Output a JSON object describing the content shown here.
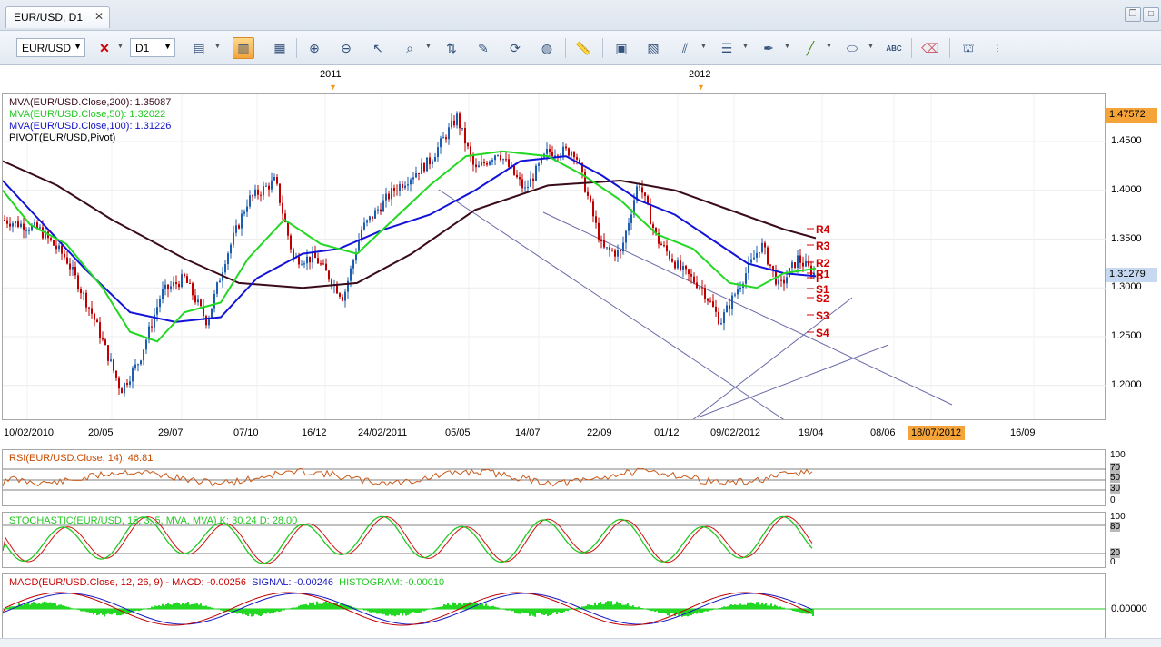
{
  "window": {
    "tab_title": "EUR/USD, D1",
    "close": "✕"
  },
  "toolbar": {
    "symbol": "EUR/USD",
    "timeframe": "D1",
    "buttons": [
      "chart-type",
      "crosshair-remove",
      "indicators",
      "candles",
      "bars",
      "zoom-in",
      "zoom-out",
      "cursor",
      "magnify",
      "trendline",
      "fib",
      "reload",
      "globe",
      "ruler",
      "picture",
      "template",
      "channel",
      "levels",
      "pen",
      "line",
      "ellipse",
      "text",
      "eraser",
      "tree"
    ]
  },
  "price_chart": {
    "top_labels": {
      "y2011": "2011",
      "y2012": "2012"
    },
    "legend": {
      "ma200": "MVA(EUR/USD.Close,200): 1.35087",
      "ma50": "MVA(EUR/USD.Close,50): 1.32022",
      "ma100": "MVA(EUR/USD.Close,100): 1.31226",
      "pivot": "PIVOT(EUR/USD,Pivot)"
    },
    "colors": {
      "ma200": "#3a0b1a",
      "ma50": "#22d822",
      "ma100": "#1313d8",
      "up": "#1e5eb0",
      "down": "#c00000",
      "pivot": "#d00000",
      "channel": "#6a6aa8"
    },
    "y_ticks": [
      "1.4500",
      "1.4000",
      "1.3500",
      "1.3000",
      "1.2500",
      "1.2000"
    ],
    "price_high_badge": "1.47572",
    "price_current_badge": "1.31279",
    "pivot_labels": [
      "R4",
      "R3",
      "R2",
      "R1",
      "P",
      "S1",
      "S2",
      "S3",
      "S4"
    ],
    "x_ticks": [
      "10/02/2010",
      "20/05",
      "29/07",
      "07/10",
      "16/12",
      "24/02/2011",
      "05/05",
      "14/07",
      "22/09",
      "01/12",
      "09/02/2012",
      "19/04",
      "08/06",
      "18/07/2012",
      "16/09"
    ]
  },
  "rsi": {
    "legend": "RSI(EUR/USD.Close, 14): 46.81",
    "ticks": [
      "100",
      "70",
      "50",
      "30",
      "0"
    ]
  },
  "stochastic": {
    "legend": "STOCHASTIC(EUR/USD, 15, 3, 5, MVA, MVA) K: 30.24  D: 28.00",
    "ticks": [
      "100",
      "80",
      "20",
      "0"
    ]
  },
  "macd": {
    "legend_main": "MACD(EUR/USD.Close, 12, 26, 9) - MACD: -0.00256",
    "legend_signal": "SIGNAL: -0.00246",
    "legend_hist": "HISTOGRAM: -0.00010",
    "tick": "0.00000"
  }
}
